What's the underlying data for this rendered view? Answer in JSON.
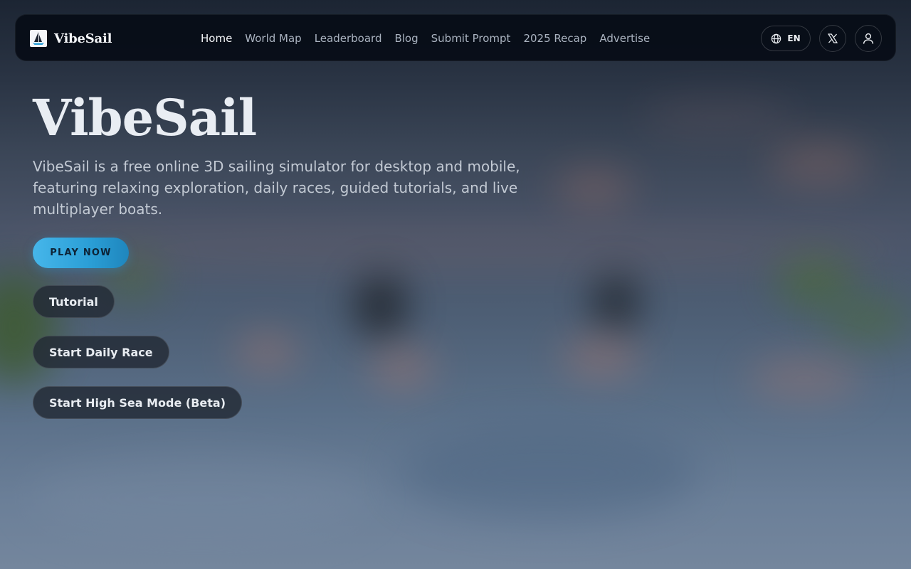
{
  "brand": {
    "name": "VibeSail",
    "logo_icon": "sailboat-icon"
  },
  "nav": {
    "links": [
      {
        "label": "Home",
        "active": true
      },
      {
        "label": "World Map",
        "active": false
      },
      {
        "label": "Leaderboard",
        "active": false
      },
      {
        "label": "Blog",
        "active": false
      },
      {
        "label": "Submit Prompt",
        "active": false
      },
      {
        "label": "2025 Recap",
        "active": false
      },
      {
        "label": "Advertise",
        "active": false
      }
    ],
    "language": {
      "label": "EN",
      "icon": "globe-icon"
    },
    "social_icon": "x-logo-icon",
    "account_icon": "user-icon"
  },
  "hero": {
    "title": "VibeSail",
    "description": "VibeSail is a free online 3D sailing simulator for desktop and mobile, featuring relaxing exploration, daily races, guided tutorials, and live multiplayer boats.",
    "play_label": "PLAY NOW",
    "tutorial_label": "Tutorial",
    "daily_race_label": "Start Daily Race",
    "high_sea_label": "Start High Sea Mode (Beta)"
  },
  "colors": {
    "accent": "#2a9ed6",
    "nav_bg": "#060c16",
    "text_primary": "#e9edf3"
  }
}
